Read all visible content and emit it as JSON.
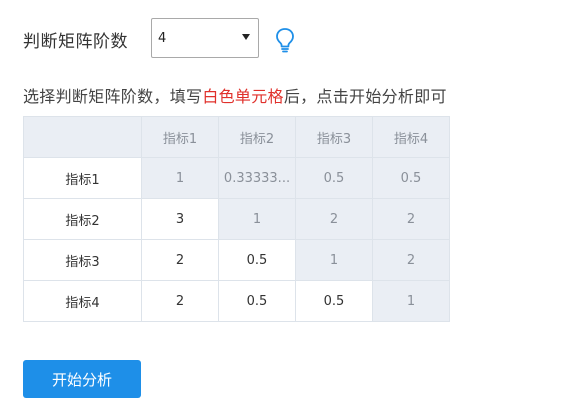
{
  "order_selector": {
    "label": "判断矩阵阶数",
    "selected_value": "4"
  },
  "help_icon": "lightbulb-icon",
  "instruction": {
    "prefix": "选择判断矩阵阶数，填写",
    "highlight": "白色单元格",
    "suffix": "后，点击开始分析即可"
  },
  "matrix": {
    "column_headers": [
      "",
      "指标1",
      "指标2",
      "指标3",
      "指标4"
    ],
    "rows": [
      {
        "label": "指标1",
        "cells": [
          "1",
          "0.33333...",
          "0.5",
          "0.5"
        ]
      },
      {
        "label": "指标2",
        "cells": [
          "3",
          "1",
          "2",
          "2"
        ]
      },
      {
        "label": "指标3",
        "cells": [
          "2",
          "0.5",
          "1",
          "2"
        ]
      },
      {
        "label": "指标4",
        "cells": [
          "2",
          "0.5",
          "0.5",
          "1"
        ]
      }
    ]
  },
  "start_button": {
    "label": "开始分析"
  },
  "colors": {
    "accent": "#1e8fe8",
    "highlight_text": "#e0302b",
    "computed_cell_bg": "#eaeef4"
  }
}
